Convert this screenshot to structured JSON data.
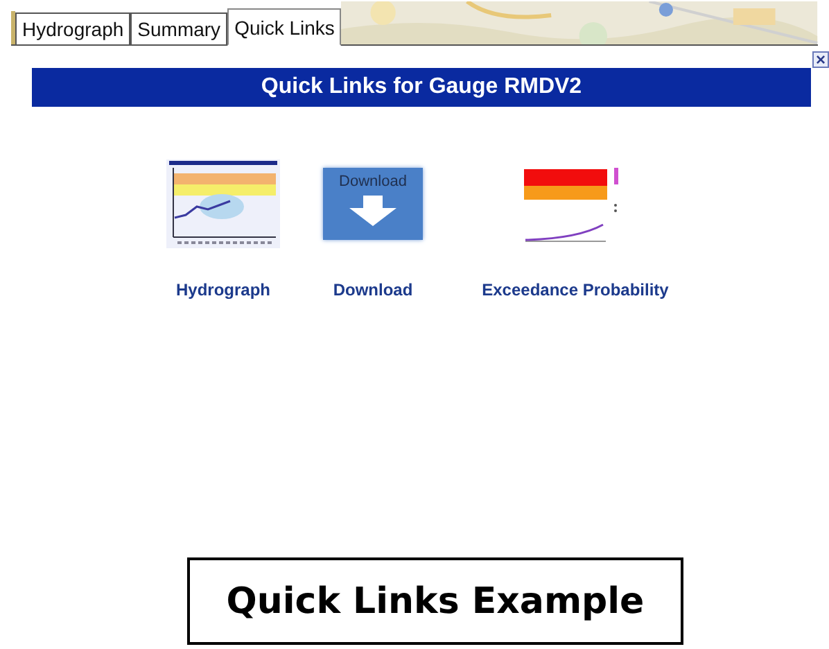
{
  "tabs": [
    {
      "label": "Hydrograph",
      "selected": false
    },
    {
      "label": "Summary",
      "selected": false
    },
    {
      "label": "Quick Links",
      "selected": true
    }
  ],
  "panel": {
    "close_glyph": "×",
    "title": "Quick Links for Gauge RMDV2",
    "links": [
      {
        "kind": "hydrograph",
        "label": "Hydrograph"
      },
      {
        "kind": "download",
        "label": "Download",
        "thumb_text": "Download"
      },
      {
        "kind": "exceedance",
        "label": "Exceedance Probability"
      }
    ]
  },
  "caption": "Quick Links Example"
}
